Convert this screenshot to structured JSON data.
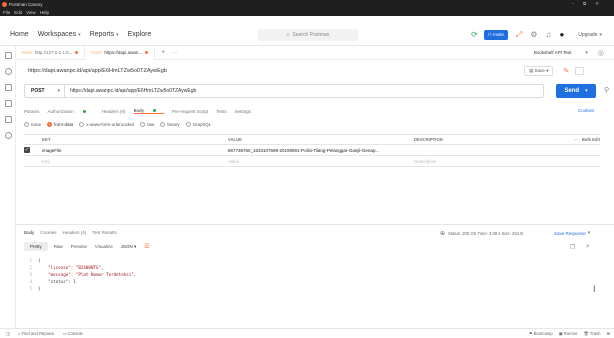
{
  "window": {
    "title": "Postman Canary",
    "menu": [
      "File",
      "Edit",
      "View",
      "Help"
    ],
    "controls": [
      "−",
      "⧉",
      "✕"
    ]
  },
  "header": {
    "home": "Home",
    "workspaces": "Workspaces",
    "reports": "Reports",
    "explore": "Explore",
    "search_placeholder": "Search Postman",
    "invite": "Invite",
    "upgrade": "Upgrade"
  },
  "tabs": [
    {
      "verb": "POST",
      "label": "http://127.0.0.1:8..."
    },
    {
      "verb": "POST",
      "label": "https://dapi.awan..."
    }
  ],
  "environment": "Bookshelf API Test",
  "request": {
    "name": "https://dapi.awanpc.id/api/app/E6HmLTZw5o0TZAywEgb",
    "method": "POST",
    "url": "https://dapi.awanpc.id/api/app/E6HmLTZw5o0TZAywEgb",
    "save_label": "Save",
    "send_label": "Send",
    "tabs": [
      "Params",
      "Authorization",
      "Headers (9)",
      "Body",
      "Pre-request Script",
      "Tests",
      "Settings"
    ],
    "cookies": "Cookies"
  },
  "body_types": [
    "none",
    "form-data",
    "x-www-form-urlencoded",
    "raw",
    "binary",
    "GraphQL"
  ],
  "form_table": {
    "headers": [
      "KEY",
      "VALUE",
      "DESCRIPTION",
      "Bulk Edit"
    ],
    "rows": [
      {
        "key": "imageFile",
        "value": "867736760_1633107698-20190801-Polisi-Tilang-Pelanggar-Ganjil-Genap...",
        "description": ""
      }
    ],
    "placeholder": {
      "key": "Key",
      "value": "Value",
      "description": "Description"
    }
  },
  "response": {
    "tabs": [
      "Body",
      "Cookies",
      "Headers (4)",
      "Test Results"
    ],
    "status": "Status: 200 OK  Time: 3.08 s  Size: 264 B",
    "save_response": "Save Response",
    "views": [
      "Pretty",
      "Raw",
      "Preview",
      "Visualize"
    ],
    "format": "JSON",
    "code_lines": [
      "{",
      "    \"license\": \"B2400NTG\",",
      "    \"message\": \"Plat Nomor Terdeteksi\",",
      "    \"status\": 1",
      "}"
    ]
  },
  "footer": {
    "find_replace": "Find and Replace",
    "console": "Console",
    "bootcamp": "Bootcamp",
    "runner": "Runner",
    "trash": "Trash"
  }
}
